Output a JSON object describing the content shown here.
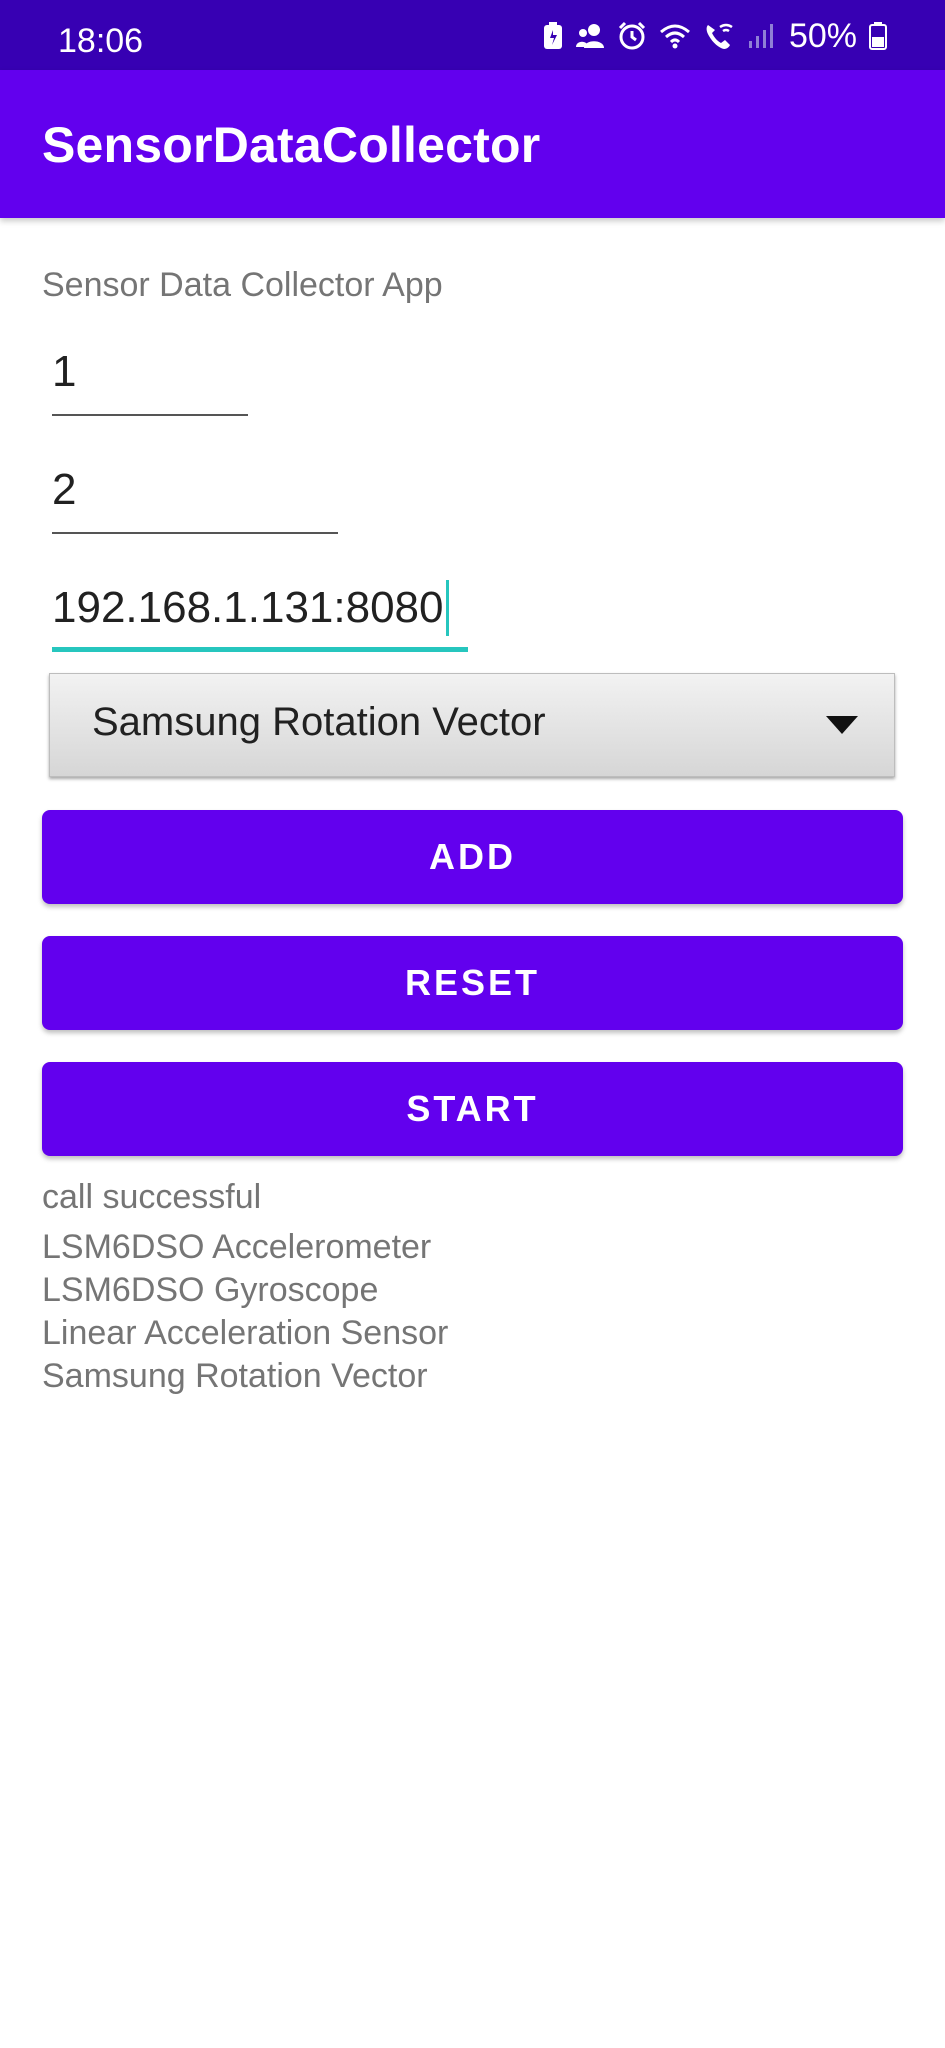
{
  "status_bar": {
    "time": "18:06",
    "battery": "50%",
    "icons": [
      "battery-saver-icon",
      "people-icon",
      "alarm-icon",
      "wifi-icon",
      "wifi-call-icon",
      "signal-icon",
      "battery-icon"
    ]
  },
  "app_bar": {
    "title": "SensorDataCollector"
  },
  "main": {
    "subtitle": "Sensor Data Collector App",
    "field1_value": "1",
    "field2_value": "2",
    "field3_value": "192.168.1.131:8080",
    "spinner_selected": "Samsung Rotation Vector",
    "buttons": {
      "add": "ADD",
      "reset": "RESET",
      "start": "START"
    },
    "result_text": "call successful",
    "sensors": [
      "LSM6DSO Accelerometer",
      "LSM6DSO Gyroscope",
      "Linear Acceleration Sensor",
      "Samsung Rotation Vector"
    ]
  },
  "colors": {
    "status_bar": "#3700b3",
    "primary": "#6200ee",
    "accent": "#26c6be"
  }
}
